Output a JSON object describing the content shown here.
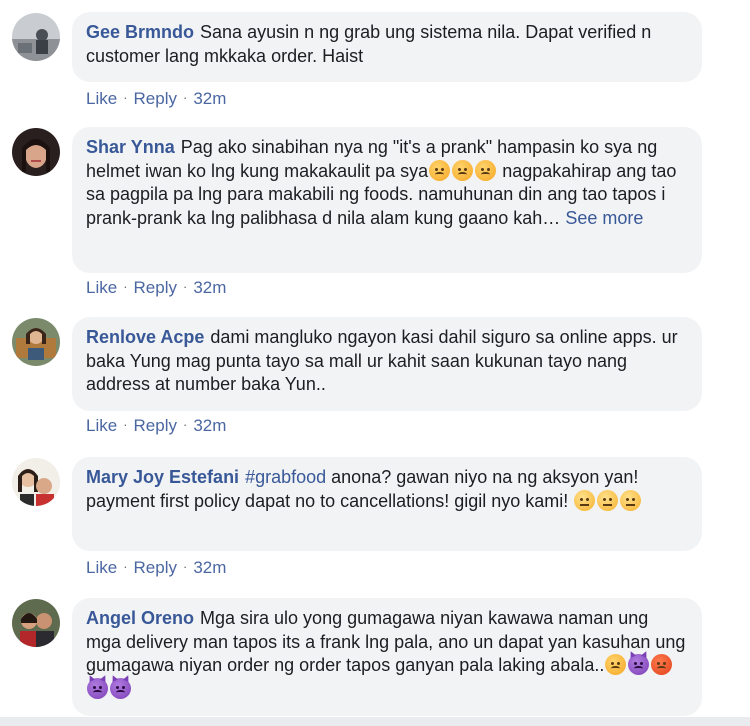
{
  "comments": [
    {
      "author": "Gee Brmndo",
      "text": "Sana ayusin n ng grab ung sistema nila. Dapat verified n customer lang mkkaka order. Haist",
      "actions": {
        "like": "Like",
        "reply": "Reply",
        "time": "32m"
      }
    },
    {
      "author": "Shar Ynna",
      "text": "Pag ako sinabihan nya ng \"it's a prank\" hampasin ko sya ng helmet iwan ko lng kung makakaulit pa sya",
      "text2": "nagpakahirap ang tao sa pagpila pa lng para makabili ng foods. namuhunan din ang tao tapos i prank-prank ka lng palibhasa d nila alam kung gaano kah…",
      "see_more": "See more",
      "emojis": [
        "pouting-face",
        "pouting-face",
        "pouting-face"
      ],
      "actions": {
        "like": "Like",
        "reply": "Reply",
        "time": "32m"
      }
    },
    {
      "author": "Renlove Acpe",
      "text": "dami mangluko ngayon kasi dahil siguro sa online apps. ur baka Yung mag punta tayo sa mall ur kahit saan kukunan tayo nang address at number baka Yun..",
      "actions": {
        "like": "Like",
        "reply": "Reply",
        "time": "32m"
      }
    },
    {
      "author": "Mary Joy Estefani",
      "hashtag": "#grabfood",
      "text": "anona? gawan niyo na ng aksyon yan! payment first policy dapat no to cancellations! gigil nyo kami!",
      "emojis": [
        "unamused-face",
        "unamused-face",
        "unamused-face"
      ],
      "actions": {
        "like": "Like",
        "reply": "Reply",
        "time": "32m"
      }
    },
    {
      "author": "Angel Oreno",
      "text": "Mga sira ulo yong gumagawa niyan kawawa naman ung mga delivery man tapos its a frank lng pala, ano un dapat yan kasuhan ung gumagawa niyan order ng order tapos ganyan pala laking abala..",
      "emojis": [
        "pouting-face",
        "devil-face",
        "angry-face",
        "devil-face",
        "devil-face"
      ],
      "actions": {
        "like": "Like",
        "reply": "Reply",
        "time": "32m"
      }
    }
  ],
  "colors": {
    "link": "#385898",
    "bubble": "#f2f3f5",
    "meta": "#606770"
  }
}
